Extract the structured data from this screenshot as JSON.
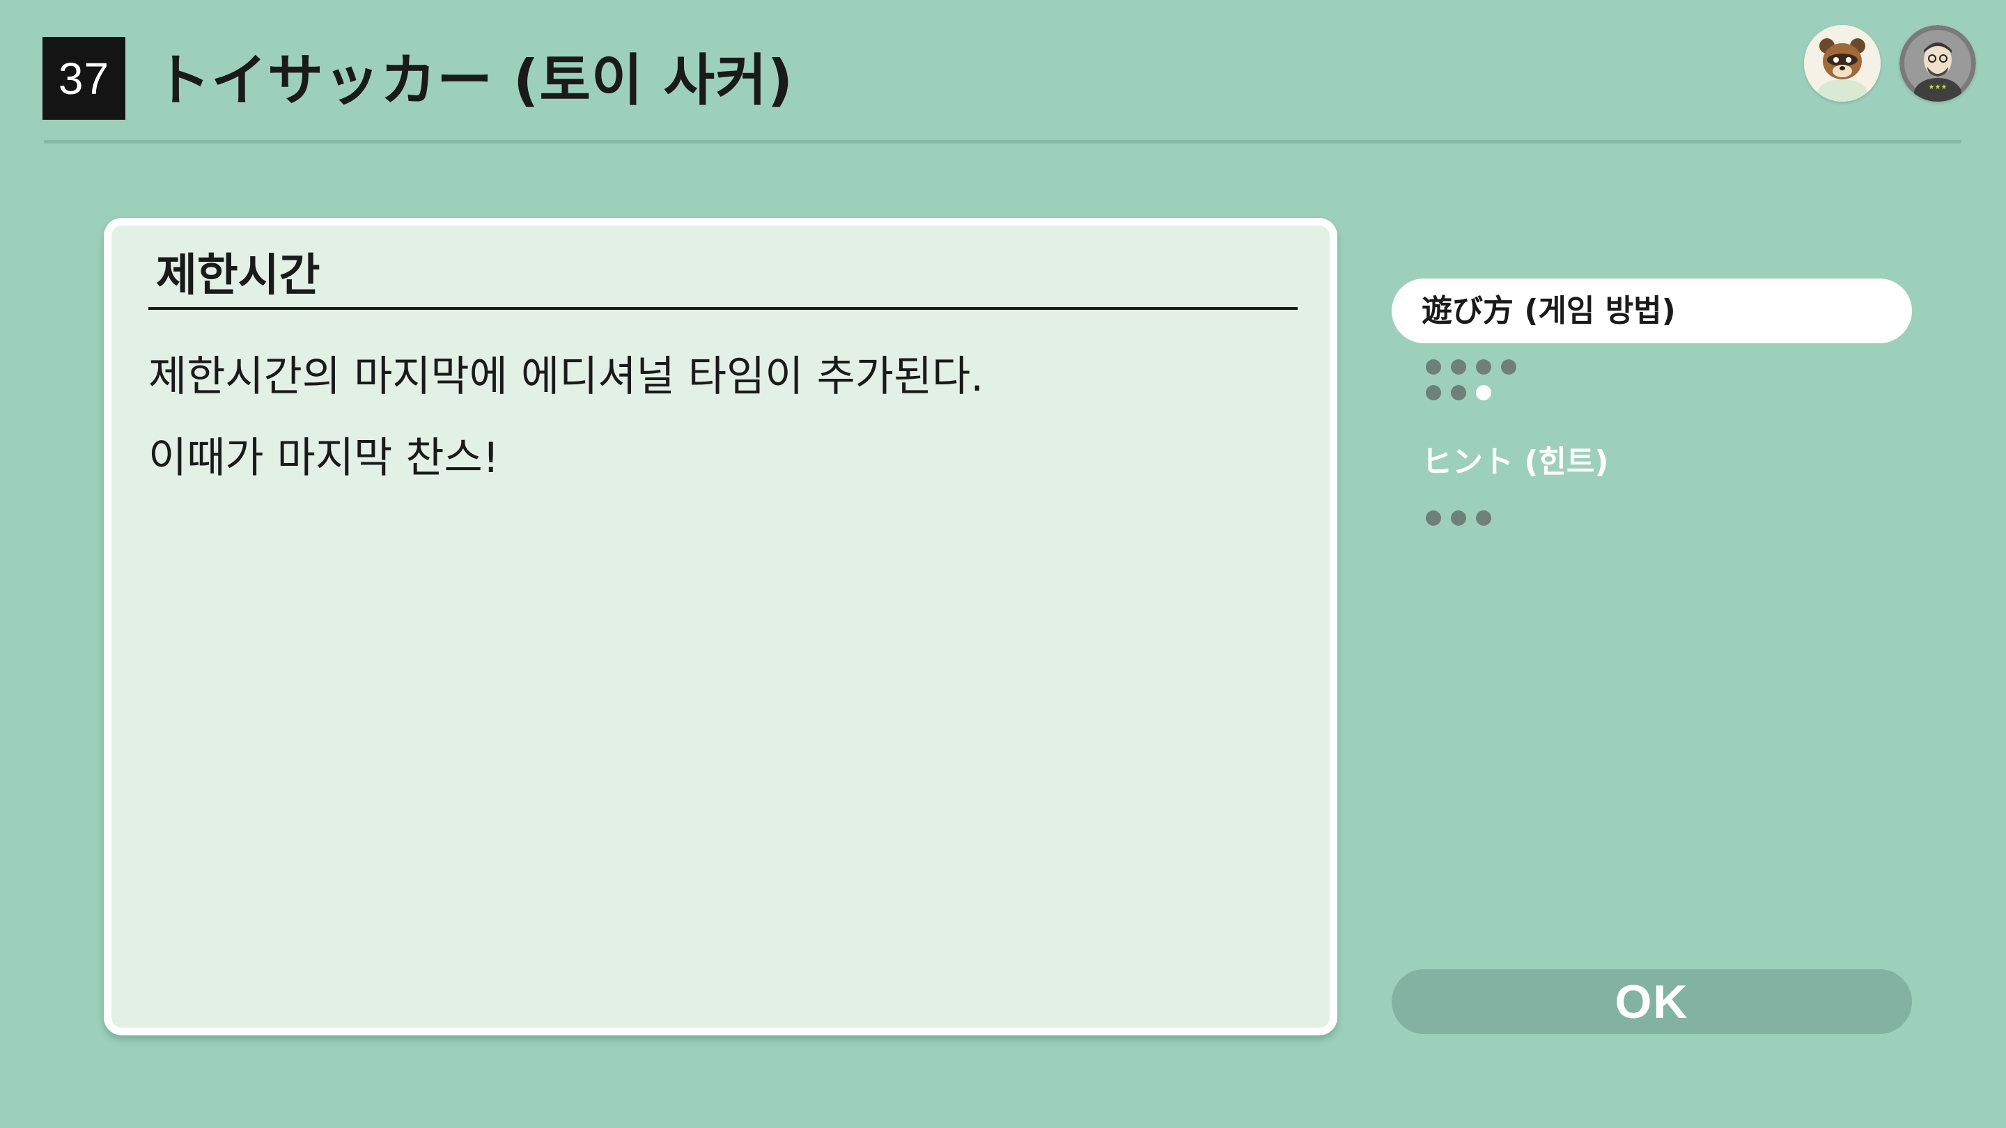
{
  "header": {
    "game_number": "37",
    "title": "トイサッカー (토이 사커)"
  },
  "avatars": [
    {
      "icon": "tom-nook-avatar-icon"
    },
    {
      "icon": "mii-avatar-icon"
    }
  ],
  "content": {
    "heading": "제한시간",
    "lines": [
      "제한시간의 마지막에 에디셔널 타임이 추가된다.",
      "이때가 마지막 찬스!"
    ]
  },
  "side_nav": {
    "items": [
      {
        "label": "遊び方 (게임 방법)",
        "selected": true,
        "pages": 7,
        "current_page": 7
      },
      {
        "label": "ヒント (힌트)",
        "selected": false,
        "pages": 3,
        "current_page": null
      }
    ]
  },
  "ok_button": {
    "label": "OK"
  },
  "colors": {
    "background": "#9dcfbd",
    "card": "#e2f0e6",
    "ok_button": "#82b2a2",
    "dot": "#6f7f79"
  }
}
